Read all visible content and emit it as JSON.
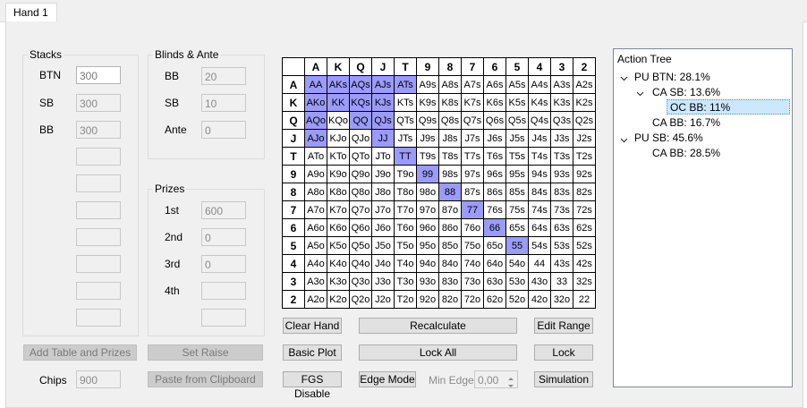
{
  "tabs": [
    {
      "label": "Hand 1"
    }
  ],
  "stacks": {
    "title": "Stacks",
    "rows": [
      {
        "label": "BTN",
        "value": "300"
      },
      {
        "label": "SB",
        "value": "300"
      },
      {
        "label": "BB",
        "value": "300"
      }
    ]
  },
  "blinds": {
    "title": "Blinds & Ante",
    "rows": [
      {
        "label": "BB",
        "value": "20"
      },
      {
        "label": "SB",
        "value": "10"
      },
      {
        "label": "Ante",
        "value": "0"
      }
    ]
  },
  "prizes": {
    "title": "Prizes",
    "rows": [
      {
        "label": "1st",
        "value": "600"
      },
      {
        "label": "2nd",
        "value": "0"
      },
      {
        "label": "3rd",
        "value": "0"
      },
      {
        "label": "4th",
        "value": ""
      }
    ]
  },
  "left_buttons": {
    "add_table": "Add Table and Prizes",
    "set_raise": "Set Raise",
    "paste": "Paste from Clipboard",
    "chips_label": "Chips",
    "chips_value": "900"
  },
  "range_grid": {
    "ranks": [
      "A",
      "K",
      "Q",
      "J",
      "T",
      "9",
      "8",
      "7",
      "6",
      "5",
      "4",
      "3",
      "2"
    ],
    "selected": [
      "AA",
      "AKs",
      "AQs",
      "AJs",
      "ATs",
      "AKo",
      "KK",
      "KQs",
      "KJs",
      "AQo",
      "QQ",
      "QJs",
      "AJo",
      "JJ",
      "TT",
      "99",
      "88",
      "77",
      "66",
      "55"
    ],
    "selected_color": "#9b9bff"
  },
  "grid_buttons": {
    "clear_hand": "Clear Hand",
    "recalculate": "Recalculate",
    "edit_range": "Edit Range",
    "basic_plot": "Basic Plot",
    "lock_all": "Lock All",
    "lock": "Lock",
    "fgs_disable": "FGS Disable",
    "edge_mode": "Edge Mode",
    "min_edge_label": "Min Edge",
    "min_edge_value": "0,00",
    "simulation": "Simulation"
  },
  "action_tree": {
    "title": "Action Tree",
    "nodes": [
      {
        "label": "PU BTN: 28.1%"
      },
      {
        "label": "CA SB: 13.6%"
      },
      {
        "label": "OC BB: 11%"
      },
      {
        "label": "CA BB: 16.7%"
      },
      {
        "label": "PU SB: 45.6%"
      },
      {
        "label": "CA BB: 28.5%"
      }
    ]
  }
}
